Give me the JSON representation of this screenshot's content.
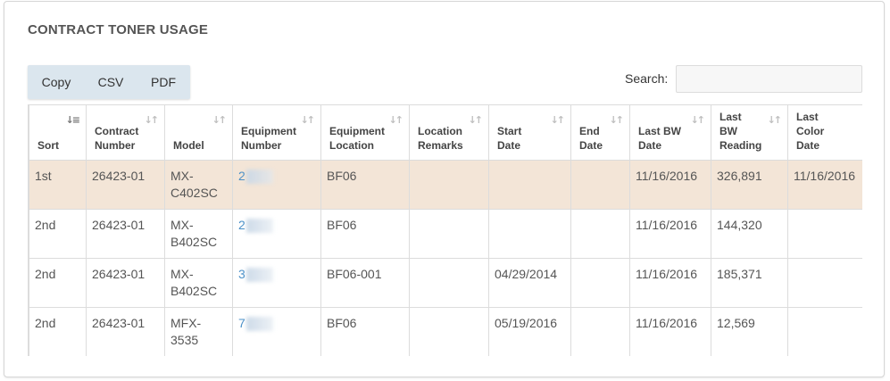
{
  "corner_mark": "\\\\",
  "panel": {
    "title": "CONTRACT TONER USAGE"
  },
  "toolbar": {
    "copy_label": "Copy",
    "csv_label": "CSV",
    "pdf_label": "PDF"
  },
  "search": {
    "label": "Search:",
    "value": "",
    "placeholder": ""
  },
  "sort_icons": {
    "active": "↓≡",
    "inactive": "↓↑"
  },
  "table": {
    "columns": [
      {
        "key": "sort",
        "label": "Sort",
        "width": 64,
        "active": true
      },
      {
        "key": "contract_number",
        "label": "Contract\nNumber",
        "width": 88
      },
      {
        "key": "model",
        "label": "Model",
        "width": 76
      },
      {
        "key": "equipment_number",
        "label": "Equipment\nNumber",
        "width": 99
      },
      {
        "key": "equipment_location",
        "label": "Equipment\nLocation",
        "width": 99
      },
      {
        "key": "location_remarks",
        "label": "Location\nRemarks",
        "width": 89
      },
      {
        "key": "start_date",
        "label": "Start\nDate",
        "width": 92
      },
      {
        "key": "end_date",
        "label": "End\nDate",
        "width": 66
      },
      {
        "key": "last_bw_date",
        "label": "Last BW\nDate",
        "width": 91
      },
      {
        "key": "last_bw_reading",
        "label": "Last\nBW\nReading",
        "width": 86
      },
      {
        "key": "last_color_date",
        "label": "Last\nColor\nDate",
        "width": 150
      }
    ],
    "rows": [
      {
        "sort": "1st",
        "contract_number": "26423-01",
        "model": "MX-\nC402SC",
        "equipment_number": "2",
        "equipment_location": "BF06",
        "location_remarks": "",
        "start_date": "",
        "end_date": "",
        "last_bw_date": "11/16/2016",
        "last_bw_reading": "326,891",
        "last_color_date": "11/16/2016",
        "highlight": true
      },
      {
        "sort": "2nd",
        "contract_number": "26423-01",
        "model": "MX-\nB402SC",
        "equipment_number": "2",
        "equipment_location": "BF06",
        "location_remarks": "",
        "start_date": "",
        "end_date": "",
        "last_bw_date": "11/16/2016",
        "last_bw_reading": "144,320",
        "last_color_date": ""
      },
      {
        "sort": "2nd",
        "contract_number": "26423-01",
        "model": "MX-\nB402SC",
        "equipment_number": "3",
        "equipment_location": "BF06-001",
        "location_remarks": "",
        "start_date": "04/29/2014",
        "end_date": "",
        "last_bw_date": "11/16/2016",
        "last_bw_reading": "185,371",
        "last_color_date": ""
      },
      {
        "sort": "2nd",
        "contract_number": "26423-01",
        "model": "MFX-\n3535",
        "equipment_number": "7",
        "equipment_location": "BF06",
        "location_remarks": "",
        "start_date": "05/19/2016",
        "end_date": "",
        "last_bw_date": "11/16/2016",
        "last_bw_reading": "12,569",
        "last_color_date": ""
      }
    ]
  }
}
